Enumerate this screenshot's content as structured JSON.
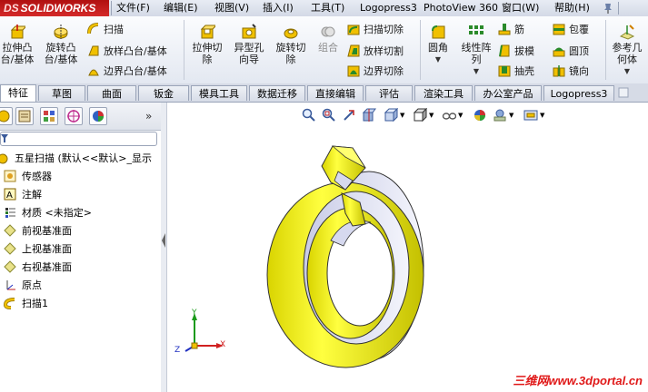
{
  "app": {
    "logo": "SOLIDWORKS",
    "logo_mark": "DS"
  },
  "menu": {
    "items": [
      "文件(F)",
      "编辑(E)",
      "视图(V)",
      "插入(I)",
      "工具(T)",
      "Logopress3",
      "PhotoView 360",
      "窗口(W)",
      "帮助(H)"
    ]
  },
  "ribbon": {
    "extrude_boss": "拉伸凸\n台/基体",
    "revolve_boss": "旋转凸\n台/基体",
    "sweep": "扫描",
    "loft_boss": "放样凸台/基体",
    "boundary_boss": "边界凸台/基体",
    "extrude_cut": "拉伸切\n除",
    "hole_wizard": "异型孔\n向导",
    "revolve_cut": "旋转切\n除",
    "combine": "组合",
    "swept_cut": "扫描切除",
    "lofted_cut": "放样切割",
    "boundary_cut": "边界切除",
    "fillet": "圆角",
    "linear_pattern": "线性阵\n列",
    "rib": "筋",
    "draft": "拔模",
    "shell": "抽壳",
    "wrap": "包覆",
    "dome": "圆顶",
    "mirror": "镜向",
    "ref_geometry": "参考几\n何体"
  },
  "tabs": [
    "特征",
    "草图",
    "曲面",
    "钣金",
    "模具工具",
    "数据迁移",
    "直接编辑",
    "评估",
    "渲染工具",
    "办公室产品",
    "Logopress3"
  ],
  "active_tab": "特征",
  "tree": {
    "root": "五星扫描 (默认<<默认>_显示",
    "items": [
      {
        "label": "传感器",
        "icon": "sensor-icon"
      },
      {
        "label": "注解",
        "icon": "annotation-icon"
      },
      {
        "label": "材质 <未指定>",
        "icon": "material-icon"
      },
      {
        "label": "前视基准面",
        "icon": "plane-icon"
      },
      {
        "label": "上视基准面",
        "icon": "plane-icon"
      },
      {
        "label": "右视基准面",
        "icon": "plane-icon"
      },
      {
        "label": "原点",
        "icon": "origin-icon"
      },
      {
        "label": "扫描1",
        "icon": "sweep-feature-icon"
      }
    ]
  },
  "triad": {
    "x": "X",
    "y": "Y",
    "z": "Z"
  },
  "watermark": "三维网www.3dportal.cn",
  "colors": {
    "part": "#f2ee1a",
    "part_shadow": "#b8b400",
    "face_gray": "#d8dbf0",
    "watermark": "#e01818"
  }
}
